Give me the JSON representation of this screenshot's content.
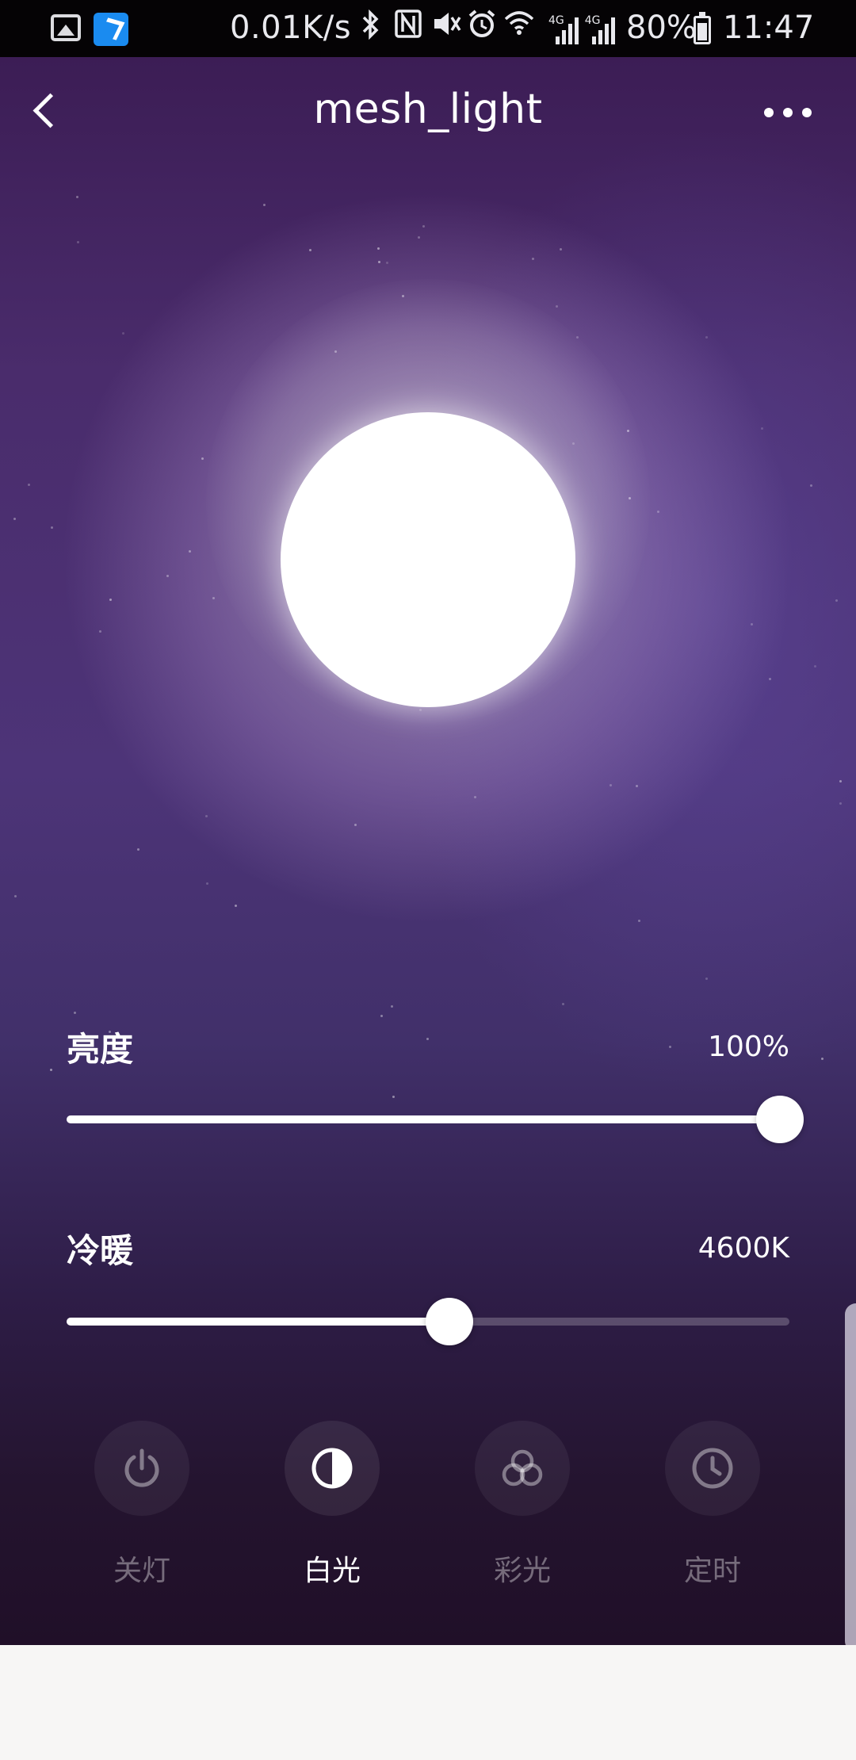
{
  "status_bar": {
    "speed": "0.01K/s",
    "battery": "80%",
    "time": "11:47",
    "net_label_1": "4G",
    "net_label_2": "4G",
    "icons": [
      "gallery-icon",
      "app-notification-icon",
      "bluetooth-icon",
      "nfc-icon",
      "mute-icon",
      "alarm-icon",
      "wifi-icon",
      "signal-icon",
      "signal-icon",
      "battery-icon"
    ]
  },
  "header": {
    "title": "mesh_light",
    "back_icon": "chevron-left-icon",
    "more_icon": "more-horizontal-icon"
  },
  "brightness": {
    "label": "亮度",
    "value_text": "100%",
    "level": 1.0
  },
  "color_temp": {
    "label": "冷暖",
    "value_text": "4600K",
    "level": 0.53
  },
  "modes": [
    {
      "label": "关灯",
      "icon": "power-icon",
      "active": false
    },
    {
      "label": "白光",
      "icon": "half-circle-icon",
      "active": true
    },
    {
      "label": "彩光",
      "icon": "color-circles-icon",
      "active": false
    },
    {
      "label": "定时",
      "icon": "clock-icon",
      "active": false
    }
  ],
  "colors": {
    "accent": "#ffffff",
    "background_top": "#3c1d55",
    "background_bottom": "#200f28",
    "status_bar": "#050305"
  }
}
